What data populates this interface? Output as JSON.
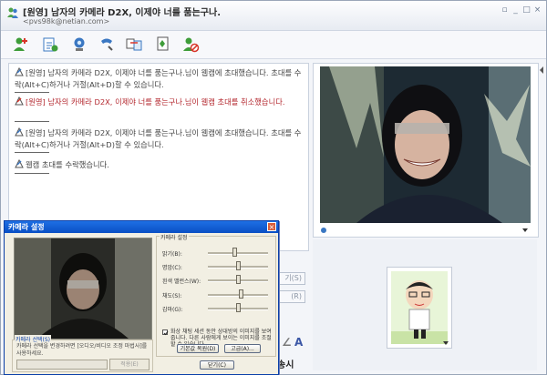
{
  "window": {
    "title": "[원영] 남자의 카메라 D2X, 이제야 너를 품는구나.",
    "subtitle": "<pvs98k@netian.com>",
    "controls": [
      "minimize",
      "maximize",
      "close"
    ]
  },
  "toolbar": {
    "tools": [
      "add-user-icon",
      "send-file-icon",
      "webcam-icon",
      "phone-icon",
      "share-icon",
      "game-icon",
      "block-icon"
    ]
  },
  "chat": {
    "messages": [
      {
        "text": "[원영] 남자의 카메라 D2X, 이제야 너를 품는구나.님이 웹캠에 초대했습니다. 초대를 수락(Alt+C)하거나 거절(Alt+D)할 수 있습니다.",
        "color": "#444444"
      },
      {
        "text": "[원영] 남자의 카메라 D2X, 이제야 너를 품는구나.님이 웹캠 초대를 취소했습니다.",
        "color": "#b3262d"
      },
      {
        "text": "[원영] 남자의 카메라 D2X, 이제야 너를 품는구나.님이 웹캠에 초대했습니다. 초대를 수락(Alt+C)하거나 거절(Alt+D)할 수 있습니다.",
        "color": "#444444"
      },
      {
        "text": "웹캠 초대를 수락했습니다.",
        "color": "#444444"
      }
    ]
  },
  "side_buttons": [
    "기(S)",
    "(R)"
  ],
  "format_buttons": [
    "∠",
    "A"
  ],
  "send_label": "송시",
  "dialog": {
    "title": "카메라 설정",
    "close": "×",
    "camera_group_label": "카메라 선택(S)",
    "camera_group_desc": "카메라 선택을 변경하려면 [오디오/비디오 조정 마법사]를 사용하세요.",
    "apply_label": "적용(E)",
    "settings_group_label": "카메라 설정",
    "sliders": [
      {
        "label": "밝기(B):",
        "value": 0.45
      },
      {
        "label": "명암(C):",
        "value": 0.5
      },
      {
        "label": "흰색 밸런스(W):",
        "value": 0.5
      },
      {
        "label": "채도(S):",
        "value": 0.55
      },
      {
        "label": "감마(G):",
        "value": 0.5
      }
    ],
    "checkbox_label": "화상 채팅 세션 동안 상대방의 이미지를 보여줍니다. 다른 사람에게 보이는 이미지를 조절할 수 있습니다.",
    "checkbox_checked": true,
    "buttons": [
      "기본값 복원(D)",
      "고급(A)..."
    ],
    "ok_label": "닫기(C)"
  },
  "colors": {
    "accent": "#3b57a6",
    "dialog_title": "#0a4fc4",
    "cancel_message": "#b3262d"
  }
}
